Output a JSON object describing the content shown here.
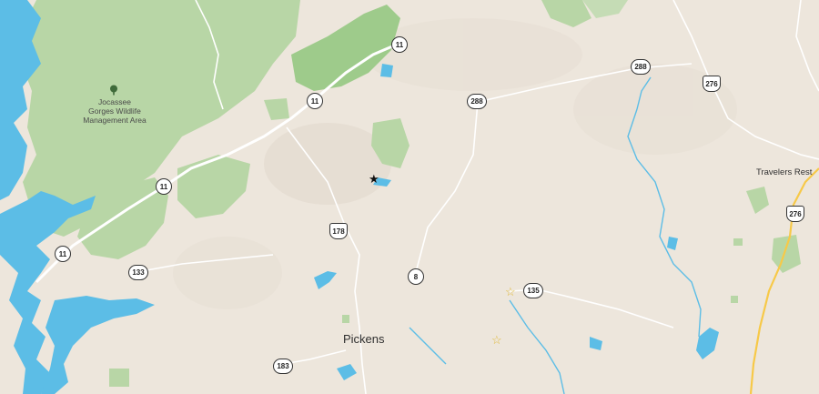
{
  "map": {
    "places": {
      "pickens": "Pickens",
      "travelers_rest": "Travelers Rest",
      "jocassee_line1": "Jocassee",
      "jocassee_line2": "Gorges Wildlife",
      "jocassee_line3": "Management Area"
    },
    "route_shields": {
      "r11_a": "11",
      "r11_b": "11",
      "r11_c": "11",
      "r11_d": "11",
      "r288_a": "288",
      "r288_b": "288",
      "r276_a": "276",
      "r276_b": "276",
      "r178": "178",
      "r8": "8",
      "r133": "133",
      "r135": "135",
      "r183": "183"
    },
    "markers": {
      "selected": "★",
      "poi_1": "☆",
      "poi_2": "☆"
    },
    "icons": {
      "park": "tree-icon",
      "selected": "black-star-icon",
      "poi": "outline-star-icon"
    },
    "colors": {
      "land": "#ede6dc",
      "forest": "#b8d6a6",
      "forest_dark": "#9ecb8b",
      "water": "#5cbde6",
      "road": "#ffffff",
      "highway": "#f7c948"
    }
  }
}
